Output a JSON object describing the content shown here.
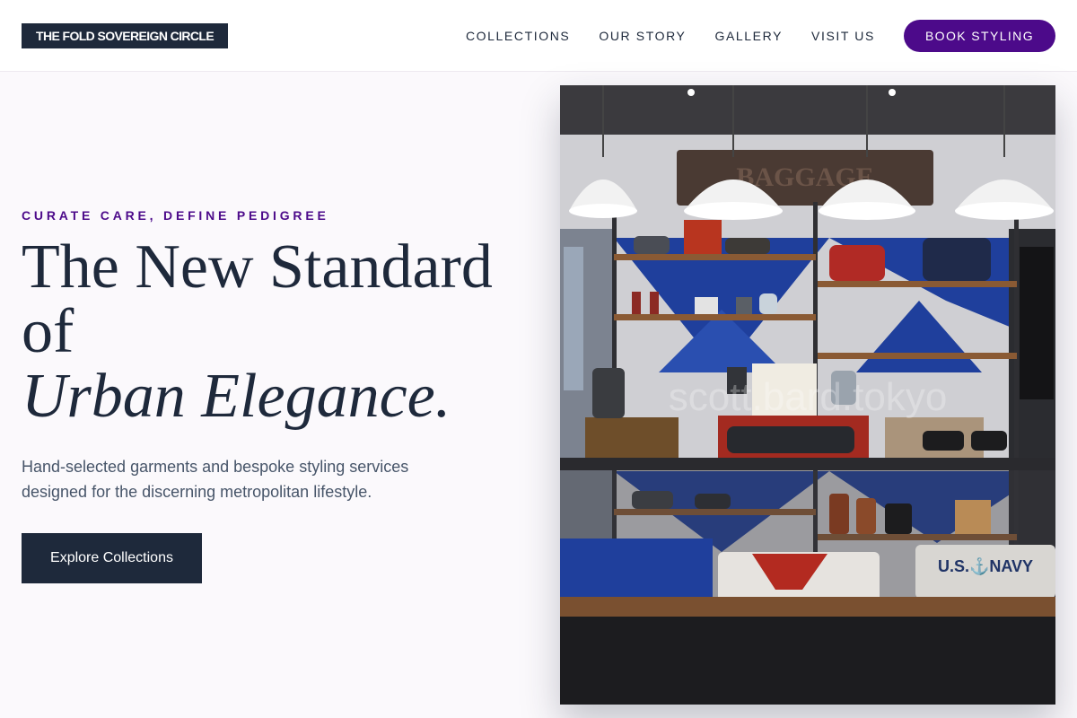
{
  "header": {
    "logo": "THE FOLD SOVEREIGN CIRCLE",
    "nav": [
      "COLLECTIONS",
      "OUR STORY",
      "GALLERY",
      "VISIT US"
    ],
    "cta": "BOOK STYLING"
  },
  "hero": {
    "eyebrow": "CURATE CARE, DEFINE PEDIGREE",
    "title_line1": "The New Standard",
    "title_line2": "of",
    "title_line3": "Urban Elegance.",
    "subtext": "Hand-selected garments and bespoke styling services designed for the discerning metropolitan lifestyle.",
    "button": "Explore Collections"
  },
  "image": {
    "alt": "Boutique store interior with shelves of clothing, shoes and bags under pendant lamps",
    "sign_text": "BAGGAGE",
    "tshirt_text": "U.S.⚓NAVY",
    "watermark": "scott.bard.tokyo"
  },
  "colors": {
    "primary": "#1e293b",
    "accent": "#4c0a8a",
    "background": "#fbf9fc",
    "body_text": "#475569"
  }
}
